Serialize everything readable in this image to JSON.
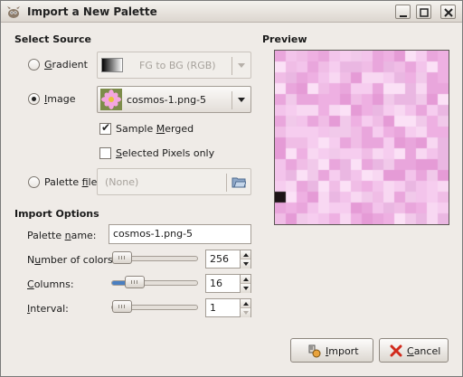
{
  "window": {
    "title": "Import a New Palette"
  },
  "source": {
    "heading": "Select Source",
    "gradient": {
      "label_prefix": "",
      "label_underline": "G",
      "label_rest": "radient",
      "combo_value": "FG to BG (RGB)",
      "selected": false
    },
    "image": {
      "label_prefix": "",
      "label_underline": "I",
      "label_rest": "mage",
      "combo_value": "cosmos-1.png-5",
      "selected": true
    },
    "sample_merged": {
      "label_prefix": "Sample ",
      "label_underline": "M",
      "label_rest": "erged",
      "checked": true
    },
    "selected_pixels": {
      "label_prefix": "",
      "label_underline": "S",
      "label_rest": "elected Pixels only",
      "checked": false
    },
    "palette_file": {
      "label_prefix": "Palette ",
      "label_underline": "f",
      "label_rest": "ile",
      "value": "(None)",
      "selected": false
    }
  },
  "preview": {
    "heading": "Preview"
  },
  "options": {
    "heading": "Import Options",
    "palette_name": {
      "label_prefix": "Palette ",
      "label_underline": "n",
      "label_rest": "ame:",
      "value": "cosmos-1.png-5"
    },
    "num_colors": {
      "label_prefix": "N",
      "label_underline": "u",
      "label_rest": "mber of colors:",
      "value": "256",
      "fraction": 0.0
    },
    "columns": {
      "label_prefix": "",
      "label_underline": "C",
      "label_rest": "olumns:",
      "value": "16",
      "fraction": 0.2
    },
    "interval": {
      "label_prefix": "",
      "label_underline": "I",
      "label_rest": "nterval:",
      "value": "1",
      "fraction": 0.0
    }
  },
  "buttons": {
    "import": {
      "label_prefix": "",
      "label_underline": "I",
      "label_rest": "mport"
    },
    "cancel": {
      "label_prefix": "",
      "label_underline": "C",
      "label_rest": "ancel"
    }
  },
  "colors": {
    "accent": "#4a7fc1",
    "preview_base": "#f2c6ea"
  }
}
